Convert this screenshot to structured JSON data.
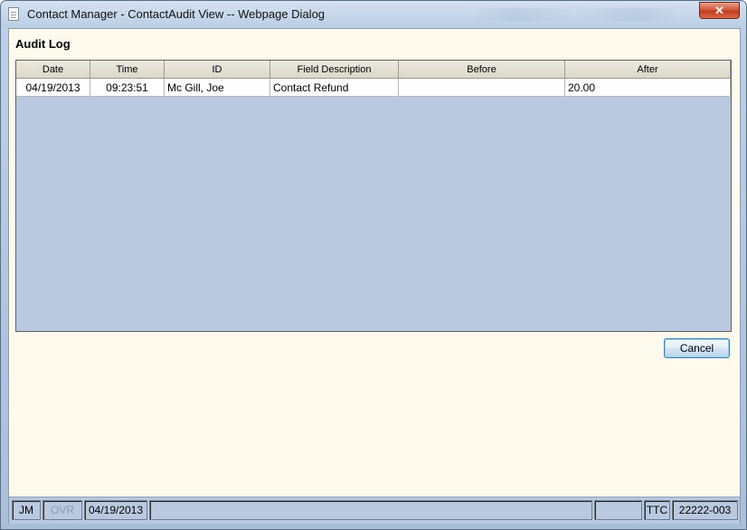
{
  "window": {
    "title": "Contact Manager - ContactAudit View -- Webpage Dialog",
    "close_glyph": "✕"
  },
  "heading": "Audit Log",
  "table": {
    "columns": [
      "Date",
      "Time",
      "ID",
      "Field Description",
      "Before",
      "After"
    ],
    "rows": [
      [
        "04/19/2013",
        "09:23:51",
        "Mc Gill, Joe",
        "Contact Refund",
        "",
        "20.00"
      ]
    ]
  },
  "buttons": {
    "cancel": "Cancel"
  },
  "statusbar": {
    "user": "JM",
    "mode": "OVR",
    "date": "04/19/2013",
    "field4": "",
    "field5": "",
    "code": "TTC",
    "ref": "22222-003"
  }
}
